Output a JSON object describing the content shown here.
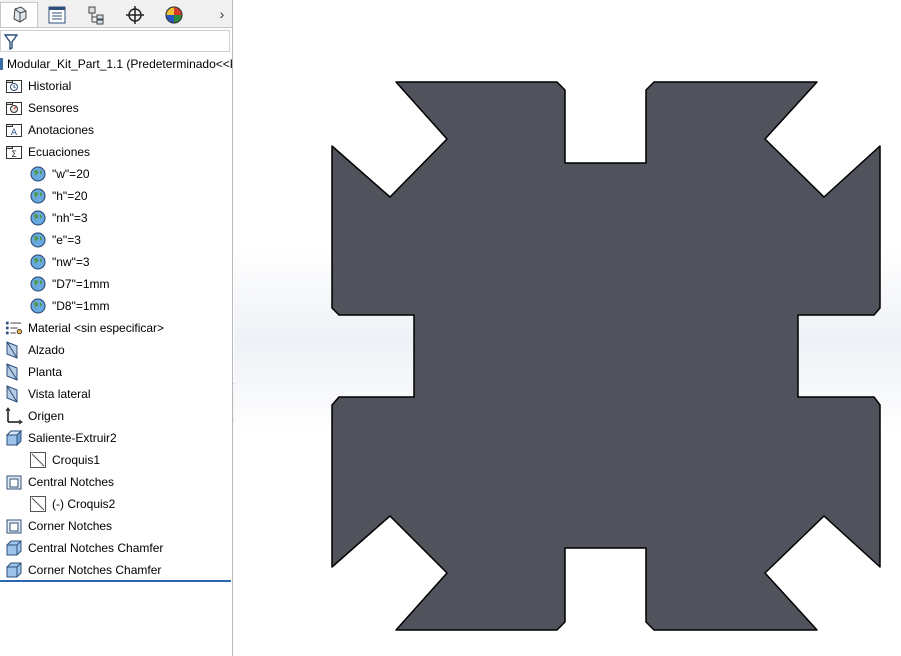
{
  "tabs": [
    {
      "name": "feature-manager-tab",
      "icon": "parts-icon",
      "active": true
    },
    {
      "name": "property-manager-tab",
      "icon": "property-list-icon",
      "active": false
    },
    {
      "name": "configuration-manager-tab",
      "icon": "configuration-icon",
      "active": false
    },
    {
      "name": "dimxpert-manager-tab",
      "icon": "crosshair-icon",
      "active": false
    },
    {
      "name": "display-manager-tab",
      "icon": "appearance-sphere-icon",
      "active": false
    }
  ],
  "tabs_expand_glyph": "›",
  "tree": {
    "root_label": "Modular_Kit_Part_1.1  (Predeterminado<<P",
    "items": [
      {
        "label": "Historial",
        "icon": "history-folder-icon",
        "indent": 0
      },
      {
        "label": "Sensores",
        "icon": "sensors-folder-icon",
        "indent": 0
      },
      {
        "label": "Anotaciones",
        "icon": "annotations-folder-icon",
        "indent": 0
      },
      {
        "label": "Ecuaciones",
        "icon": "equations-folder-icon",
        "indent": 0
      },
      {
        "label": "\"w\"=20",
        "icon": "global-variable-icon",
        "indent": 1
      },
      {
        "label": "\"h\"=20",
        "icon": "global-variable-icon",
        "indent": 1
      },
      {
        "label": "\"nh\"=3",
        "icon": "global-variable-icon",
        "indent": 1
      },
      {
        "label": "\"e\"=3",
        "icon": "global-variable-icon",
        "indent": 1
      },
      {
        "label": "\"nw\"=3",
        "icon": "global-variable-icon",
        "indent": 1
      },
      {
        "label": "\"D7\"=1mm",
        "icon": "global-variable-icon",
        "indent": 1
      },
      {
        "label": "\"D8\"=1mm",
        "icon": "global-variable-icon",
        "indent": 1
      },
      {
        "label": "Material <sin especificar>",
        "icon": "material-icon",
        "indent": 0
      },
      {
        "label": "Alzado",
        "icon": "plane-icon",
        "indent": 0
      },
      {
        "label": "Planta",
        "icon": "plane-icon",
        "indent": 0
      },
      {
        "label": "Vista lateral",
        "icon": "plane-icon",
        "indent": 0
      },
      {
        "label": "Origen",
        "icon": "origin-icon",
        "indent": 0
      },
      {
        "label": "Saliente-Extruir2",
        "icon": "boss-extrude-icon",
        "indent": 0
      },
      {
        "label": "Croquis1",
        "icon": "sketch-icon",
        "indent": 1
      },
      {
        "label": "Central Notches",
        "icon": "cut-extrude-icon",
        "indent": 0
      },
      {
        "label": "(-) Croquis2",
        "icon": "sketch-icon",
        "indent": 1
      },
      {
        "label": "Corner Notches",
        "icon": "cut-extrude-icon",
        "indent": 0
      },
      {
        "label": "Central Notches Chamfer",
        "icon": "chamfer-icon",
        "indent": 0
      },
      {
        "label": "Corner Notches Chamfer",
        "icon": "chamfer-icon",
        "indent": 0
      }
    ]
  },
  "viewport": {
    "part_fill": "#50525c",
    "part_edge": "#000000"
  }
}
